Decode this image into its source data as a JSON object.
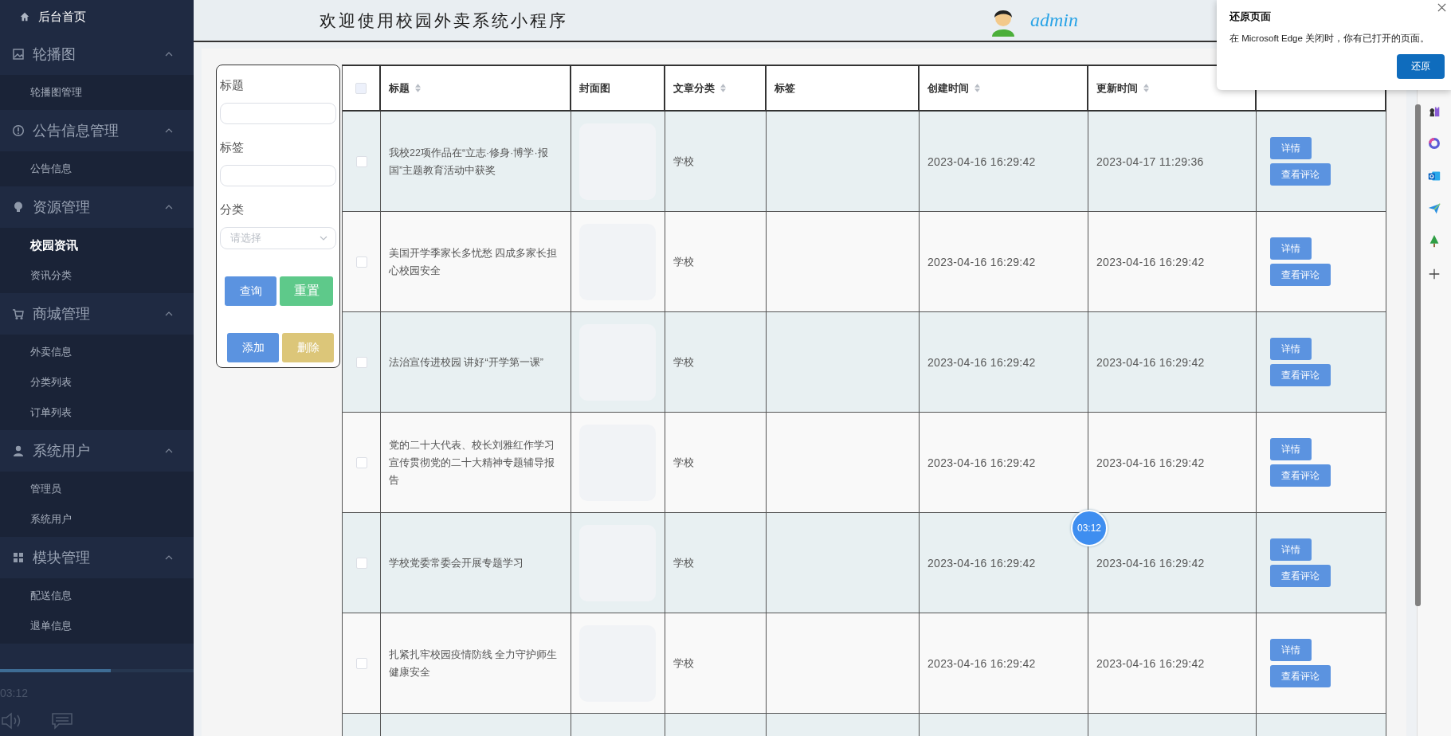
{
  "sidebar": {
    "home": {
      "label": "后台首页"
    },
    "groups": [
      {
        "label": "轮播图",
        "expanded": true,
        "items": [
          {
            "label": "轮播图管理",
            "selected": false
          }
        ]
      },
      {
        "label": "公告信息管理",
        "expanded": true,
        "items": [
          {
            "label": "公告信息",
            "selected": false
          }
        ]
      },
      {
        "label": "资源管理",
        "expanded": true,
        "items": [
          {
            "label": "校园资讯",
            "selected": true
          },
          {
            "label": "资讯分类",
            "selected": false
          }
        ]
      },
      {
        "label": "商城管理",
        "expanded": true,
        "items": [
          {
            "label": "外卖信息",
            "selected": false
          },
          {
            "label": "分类列表",
            "selected": false
          },
          {
            "label": "订单列表",
            "selected": false
          }
        ]
      },
      {
        "label": "系统用户",
        "expanded": true,
        "items": [
          {
            "label": "管理员",
            "selected": false
          },
          {
            "label": "系统用户",
            "selected": false
          }
        ]
      },
      {
        "label": "模块管理",
        "expanded": true,
        "items": [
          {
            "label": "配送信息",
            "selected": false
          },
          {
            "label": "退单信息",
            "selected": false
          }
        ]
      }
    ],
    "player": {
      "time": "03:12",
      "level": 0.57
    }
  },
  "header": {
    "title": "欢迎使用校园外卖系统小程序",
    "user": "admin"
  },
  "filter": {
    "fields": [
      {
        "label": "标题",
        "kind": "input"
      },
      {
        "label": "标签",
        "kind": "input"
      },
      {
        "label": "分类",
        "kind": "select",
        "placeholder": "请选择"
      }
    ],
    "buttons": [
      {
        "label": "查询",
        "kind": "primary"
      },
      {
        "label": "重置",
        "kind": "success"
      },
      {
        "label": "添加",
        "kind": "primary"
      },
      {
        "label": "删除",
        "kind": "warning"
      }
    ]
  },
  "table": {
    "all_checked": false,
    "columns": [
      {
        "kind": "check"
      },
      {
        "label": "标题",
        "sortable": true
      },
      {
        "label": "封面图",
        "sortable": false
      },
      {
        "label": "文章分类",
        "sortable": true
      },
      {
        "label": "标签",
        "sortable": false
      },
      {
        "label": "创建时间",
        "sortable": true
      },
      {
        "label": "更新时间",
        "sortable": true
      },
      {
        "kind": "ops"
      }
    ],
    "rows": [
      {
        "checked": false,
        "title": "我校22项作品在“立志·修身·博学·报国”主题教育活动中获奖",
        "category": "学校",
        "created": "2023-04-16 16:29:42",
        "updated": "2023-04-17 11:29:36",
        "actions": [
          "详情",
          "查看评论"
        ]
      },
      {
        "checked": false,
        "title": "美国开学季家长多忧愁 四成多家长担心校园安全",
        "category": "学校",
        "created": "2023-04-16 16:29:42",
        "updated": "2023-04-16 16:29:42",
        "actions": [
          "详情",
          "查看评论"
        ]
      },
      {
        "checked": false,
        "title": "法治宣传进校园 讲好“开学第一课”",
        "category": "学校",
        "created": "2023-04-16 16:29:42",
        "updated": "2023-04-16 16:29:42",
        "actions": [
          "详情",
          "查看评论"
        ]
      },
      {
        "checked": false,
        "title": "党的二十大代表、校长刘雅红作学习宣传贯彻党的二十大精神专题辅导报告",
        "category": "学校",
        "created": "2023-04-16 16:29:42",
        "updated": "2023-04-16 16:29:42",
        "actions": [
          "详情",
          "查看评论"
        ]
      },
      {
        "checked": false,
        "title": "学校党委常委会开展专题学习",
        "category": "学校",
        "created": "2023-04-16 16:29:42",
        "updated": "2023-04-16 16:29:42",
        "actions": [
          "详情",
          "查看评论"
        ]
      },
      {
        "checked": false,
        "title": "扎紧扎牢校园疫情防线 全力守护师生健康安全",
        "category": "学校",
        "created": "2023-04-16 16:29:42",
        "updated": "2023-04-16 16:29:42",
        "actions": [
          "详情",
          "查看评论"
        ]
      }
    ]
  },
  "video_badge": {
    "time": "03:12"
  },
  "popup": {
    "title": "还原页面",
    "message": "在 Microsoft Edge 关闭时，你有已打开的页面。",
    "button": "还原"
  }
}
